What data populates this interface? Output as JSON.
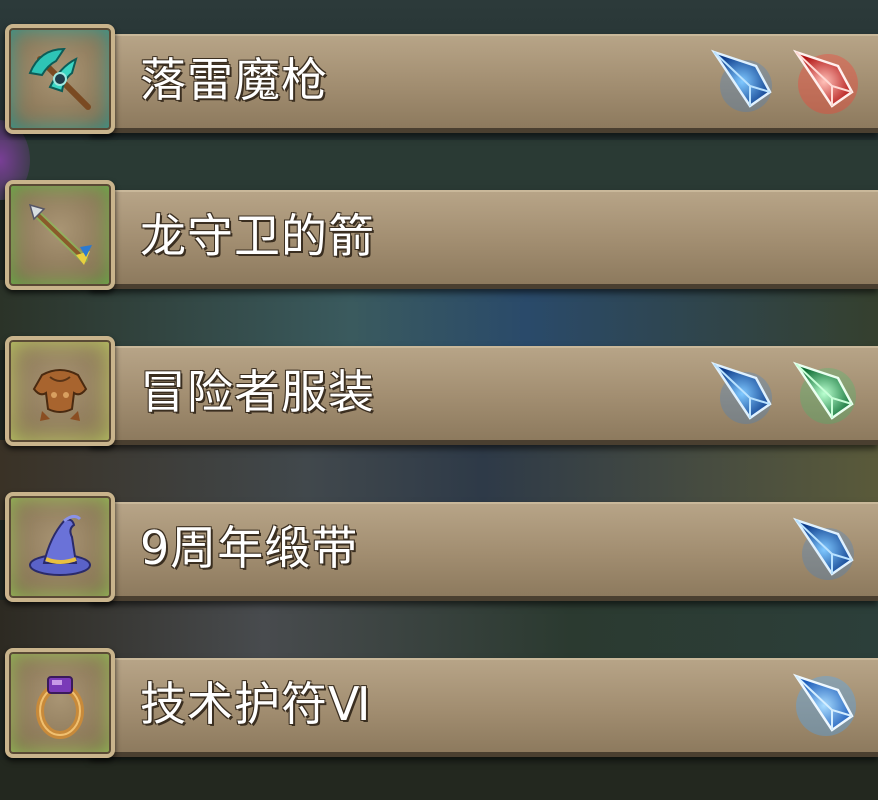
{
  "items": [
    {
      "name": "落雷魔枪",
      "icon": "battle-axe-icon",
      "glow": "#2fa39a",
      "gems": [
        "blue",
        "red"
      ]
    },
    {
      "name": "龙守卫的箭",
      "icon": "arrow-icon",
      "glow": "#6cc04a",
      "gems": []
    },
    {
      "name": "冒险者服装",
      "icon": "armor-icon",
      "glow": "#c8d86a",
      "gems": [
        "blue",
        "green"
      ]
    },
    {
      "name": "9周年缎带",
      "icon": "wizard-hat-icon",
      "glow": "#9ccc5a",
      "gems": [
        "blue"
      ]
    },
    {
      "name": "技术护符Ⅵ",
      "icon": "ring-icon",
      "glow": "#9ccc5a",
      "gems": [
        "blue"
      ]
    }
  ],
  "gem_colors": {
    "blue": "#2a7fe0",
    "red": "#ff3a30",
    "green": "#2ec86a"
  }
}
